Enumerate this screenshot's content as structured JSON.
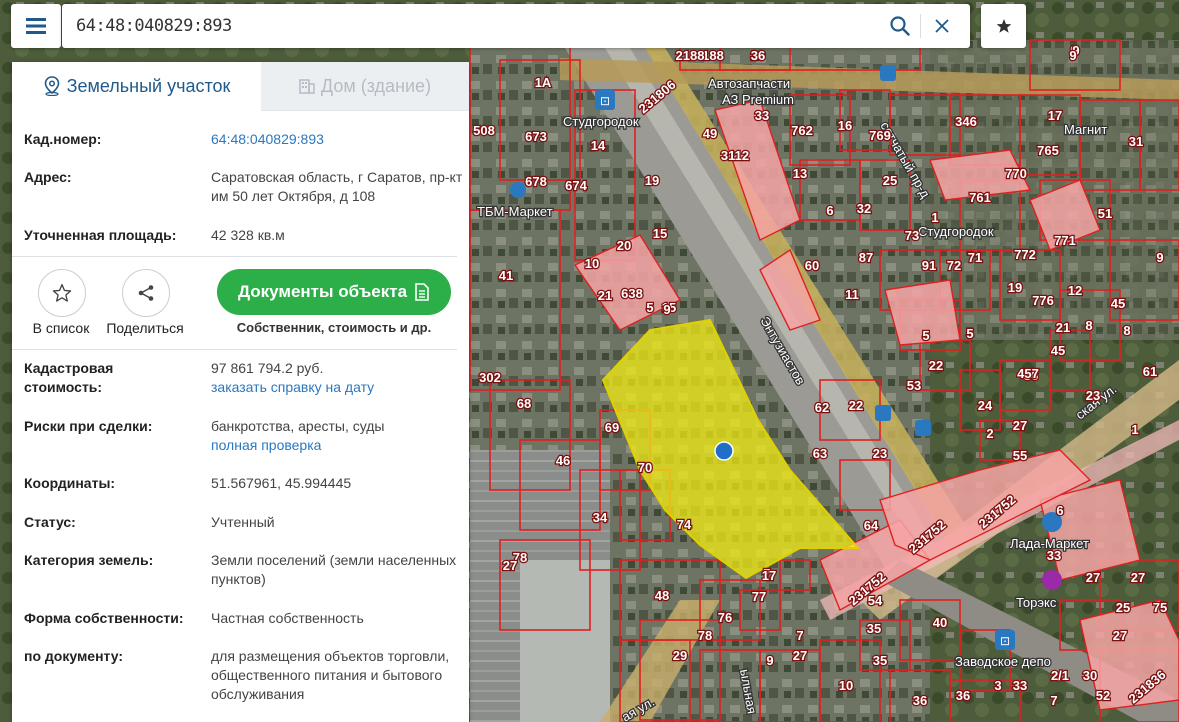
{
  "search": {
    "query": "64:48:040829:893"
  },
  "panel": {
    "tabs": [
      {
        "label": "Земельный участок",
        "active": true
      },
      {
        "label": "Дом (здание)",
        "active": false
      }
    ],
    "fields": {
      "cad_number": {
        "label": "Кад.номер:",
        "value": "64:48:040829:893"
      },
      "address": {
        "label": "Адрес:",
        "value": "Саратовская область, г Саратов, пр-кт им 50 лет Октября, д 108"
      },
      "area": {
        "label": "Уточненная площадь:",
        "value": "42 328 кв.м"
      },
      "cost": {
        "label": "Кадастровая стоимость:",
        "value": "97 861 794.2 руб.",
        "link": "заказать справку на дату"
      },
      "risks": {
        "label": "Риски при сделки:",
        "value": "банкротства, аресты, суды",
        "link": "полная проверка"
      },
      "coords": {
        "label": "Координаты:",
        "value": "51.567961, 45.994445"
      },
      "status": {
        "label": "Статус:",
        "value": "Учтенный"
      },
      "category": {
        "label": "Категория земель:",
        "value": "Земли поселений (земли населенных пунктов)"
      },
      "ownership": {
        "label": "Форма собственности:",
        "value": "Частная собственность"
      },
      "by_doc": {
        "label": "по документу:",
        "value": "для размещения объектов торговли, общественного питания и бытового обслуживания"
      }
    },
    "actions": {
      "add_to_list": "В список",
      "share": "Поделиться",
      "documents": "Документы объекта",
      "documents_sub": "Собственник, стоимость и др."
    }
  },
  "map": {
    "labels": {
      "stop1": "Студгородок",
      "stop2": "Студгородок",
      "stop3": "Заводское депо",
      "store1": "Автозапчасти",
      "store2": "АЗ Premium",
      "store3": "ТБМ-Маркет",
      "store4": "Лада-Маркет",
      "store5": "Торэкс",
      "store6": "Магнит",
      "street1": "ская ул.",
      "street2": "ая ул.",
      "street3": "сетчатый пр-д",
      "street4": "Энтузиастов",
      "street5": "ыльная"
    },
    "parcel_numbers": [
      "29",
      "188",
      "2188",
      "9",
      "9",
      "17",
      "346",
      "16",
      "31",
      "765",
      "51",
      "14",
      "673",
      "678",
      "674",
      "19",
      "49",
      "3112",
      "33",
      "762",
      "25",
      "769",
      "770",
      "761",
      "1",
      "771",
      "772",
      "5",
      "9",
      "8",
      "13",
      "6",
      "32",
      "15",
      "20",
      "10",
      "21",
      "638",
      "15",
      "87",
      "73",
      "91",
      "71",
      "72",
      "776",
      "19",
      "12",
      "41",
      "60",
      "5",
      "9",
      "77",
      "7",
      "36",
      "68",
      "69",
      "46",
      "70",
      "34",
      "74",
      "62",
      "22",
      "23",
      "53",
      "22",
      "24",
      "2",
      "457",
      "45",
      "21",
      "45",
      "1",
      "61",
      "8",
      "78",
      "48",
      "27",
      "6",
      "33",
      "27",
      "25",
      "75",
      "29",
      "76",
      "27",
      "35",
      "35",
      "40",
      "36",
      "9",
      "10",
      "36",
      "3",
      "7",
      "52",
      "54",
      "23",
      "231752",
      "231752",
      "231752",
      "231806",
      "231836",
      "1A",
      "5",
      "11",
      "9",
      "508",
      "302",
      "63",
      "64",
      "55",
      "17",
      "2/1",
      "33",
      "30",
      "27",
      "27",
      "78",
      "7",
      "27",
      "36"
    ],
    "accent": "#e02020",
    "selected_fill": "#f2ec13"
  }
}
